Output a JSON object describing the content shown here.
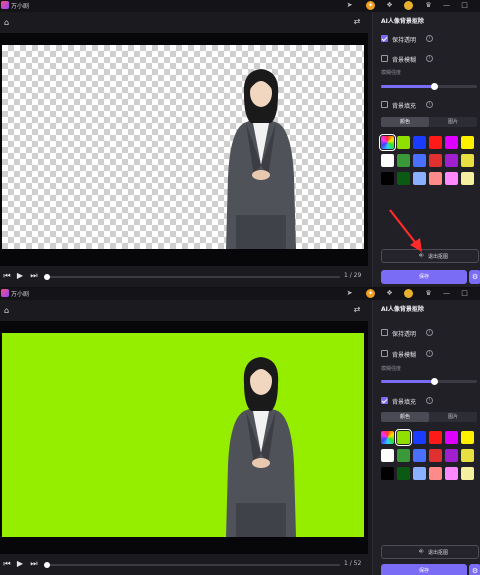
{
  "app": {
    "title": "万小剧"
  },
  "titlebar_icons": [
    "vip-icon",
    "cube-icon",
    "avatar",
    "crown-icon",
    "message-icon",
    "minimize-icon",
    "maximize-icon",
    "close-icon"
  ],
  "icons": {
    "home": "⌂",
    "swap": "⇄",
    "prev": "⏮",
    "play": "▶",
    "next": "⏭",
    "info": "i",
    "exit": "⎆",
    "settings": "⚙",
    "vip": "✦",
    "cube": "❖",
    "crown": "♛",
    "message": "✉",
    "minimize": "—",
    "maximize": "□",
    "close": "✕",
    "send": "➤"
  },
  "top": {
    "panel_title": "AI人像背景抠除",
    "opt_keep_transparent": "保持透明",
    "opt_blur": "背景模糊",
    "blur_label": "模糊强度",
    "blur_level": 0.55,
    "opt_fill": "背景填充",
    "tab_color": "颜色",
    "tab_image": "图片",
    "exit_button": "退出抠图",
    "save_button": "保存",
    "frame_count": "1 / 29",
    "checked": {
      "keep_transparent": true,
      "blur": false,
      "fill": false
    },
    "selected_swatch": 0
  },
  "bottom": {
    "panel_title": "AI人像背景抠除",
    "opt_keep_transparent": "保持透明",
    "opt_blur": "背景模糊",
    "blur_label": "模糊强度",
    "blur_level": 0.55,
    "opt_fill": "背景填充",
    "tab_color": "颜色",
    "tab_image": "图片",
    "exit_button": "退出抠图",
    "save_button": "保存",
    "frame_count": "1 / 52",
    "checked": {
      "keep_transparent": false,
      "blur": false,
      "fill": true
    },
    "selected_swatch": 1
  },
  "swatch_colors": [
    "rainbow",
    "#8fe000",
    "#1a3cff",
    "#ff1a1a",
    "#e000ff",
    "#fff000",
    "#ffffff",
    "#3a9a3a",
    "#4a70ff",
    "#e03030",
    "#a020d0",
    "#e8e040",
    "#000000",
    "#0a5a14",
    "#8ab0ff",
    "#ff8a8a",
    "#ff88ff",
    "#f4f0a0"
  ],
  "colors": {
    "accent": "#7b6cf6",
    "green_screen": "#95ee00"
  }
}
